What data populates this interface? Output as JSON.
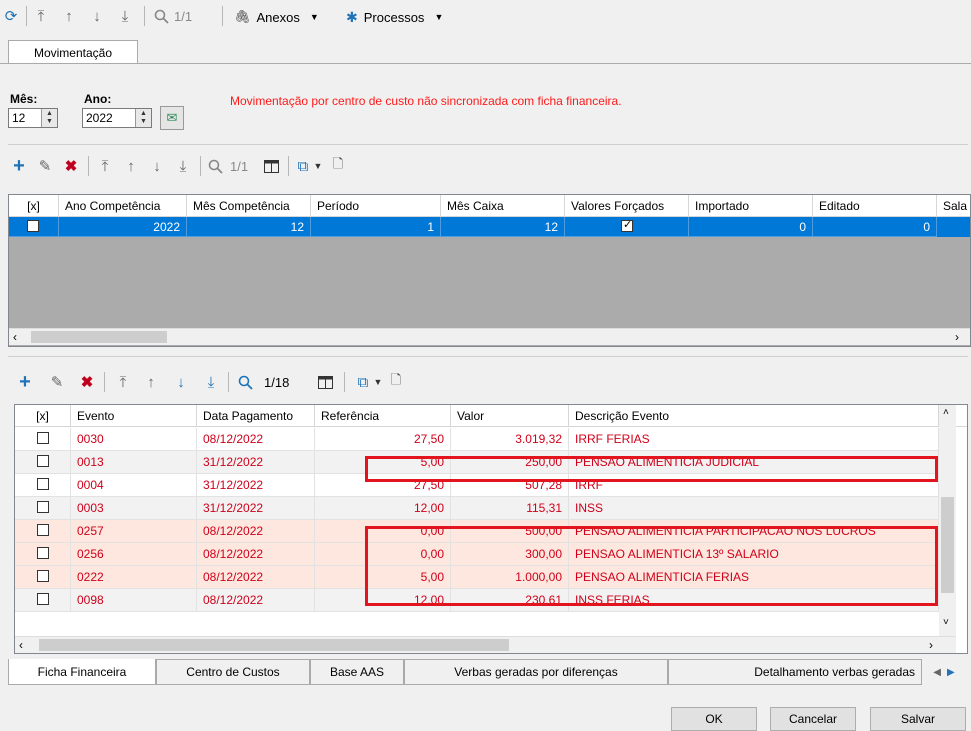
{
  "top_toolbar": {
    "record_counter": "1/1",
    "anexos_label": "Anexos",
    "processos_label": "Processos"
  },
  "tab_main": "Movimentação",
  "period": {
    "mes_label": "Mês:",
    "mes_value": "12",
    "ano_label": "Ano:",
    "ano_value": "2022",
    "warning": "Movimentação por centro de custo não sincronizada com ficha financeira."
  },
  "grid1": {
    "toolbar_counter": "1/1",
    "headers": [
      "[x]",
      "Ano Competência",
      "Mês Competência",
      "Período",
      "Mês Caixa",
      "Valores Forçados",
      "Importado",
      "Editado",
      "Sala"
    ],
    "row": {
      "ano": "2022",
      "mes": "12",
      "periodo": "1",
      "mes_caixa": "12",
      "importado": "0",
      "editado": "0"
    }
  },
  "grid2": {
    "toolbar_counter": "1/18",
    "headers": [
      "[x]",
      "Evento",
      "Data Pagamento",
      "Referência",
      "Valor",
      "Descrição Evento"
    ],
    "rows": [
      {
        "evento": "0030",
        "data": "08/12/2022",
        "ref": "27,50",
        "valor": "3.019,32",
        "desc": "IRRF FERIAS"
      },
      {
        "evento": "0013",
        "data": "31/12/2022",
        "ref": "5,00",
        "valor": "250,00",
        "desc": "PENSAO ALIMENTICIA JUDICIAL"
      },
      {
        "evento": "0004",
        "data": "31/12/2022",
        "ref": "27,50",
        "valor": "507,28",
        "desc": "IRRF"
      },
      {
        "evento": "0003",
        "data": "31/12/2022",
        "ref": "12,00",
        "valor": "115,31",
        "desc": "INSS"
      },
      {
        "evento": "0257",
        "data": "08/12/2022",
        "ref": "0,00",
        "valor": "500,00",
        "desc": "PENSAO ALIMENTICIA PARTICIPACAO NOS LUCROS"
      },
      {
        "evento": "0256",
        "data": "08/12/2022",
        "ref": "0,00",
        "valor": "300,00",
        "desc": "PENSAO ALIMENTICIA 13º SALARIO"
      },
      {
        "evento": "0222",
        "data": "08/12/2022",
        "ref": "5,00",
        "valor": "1.000,00",
        "desc": "PENSAO ALIMENTICIA  FERIAS"
      },
      {
        "evento": "0098",
        "data": "08/12/2022",
        "ref": "12,00",
        "valor": "230,61",
        "desc": "INSS FERIAS"
      }
    ]
  },
  "bottom_tabs": [
    "Ficha Financeira",
    "Centro de Custos",
    "Base AAS",
    "Verbas geradas por diferenças",
    "Detalhamento verbas geradas"
  ],
  "buttons": {
    "ok": "OK",
    "cancel": "Cancelar",
    "save": "Salvar"
  },
  "colors": {
    "selection": "#0078d7",
    "event_text": "#d0001a",
    "row_tint": "#fde7df",
    "alt_row": "#f2f2f2",
    "highlight": "#e2141e"
  }
}
